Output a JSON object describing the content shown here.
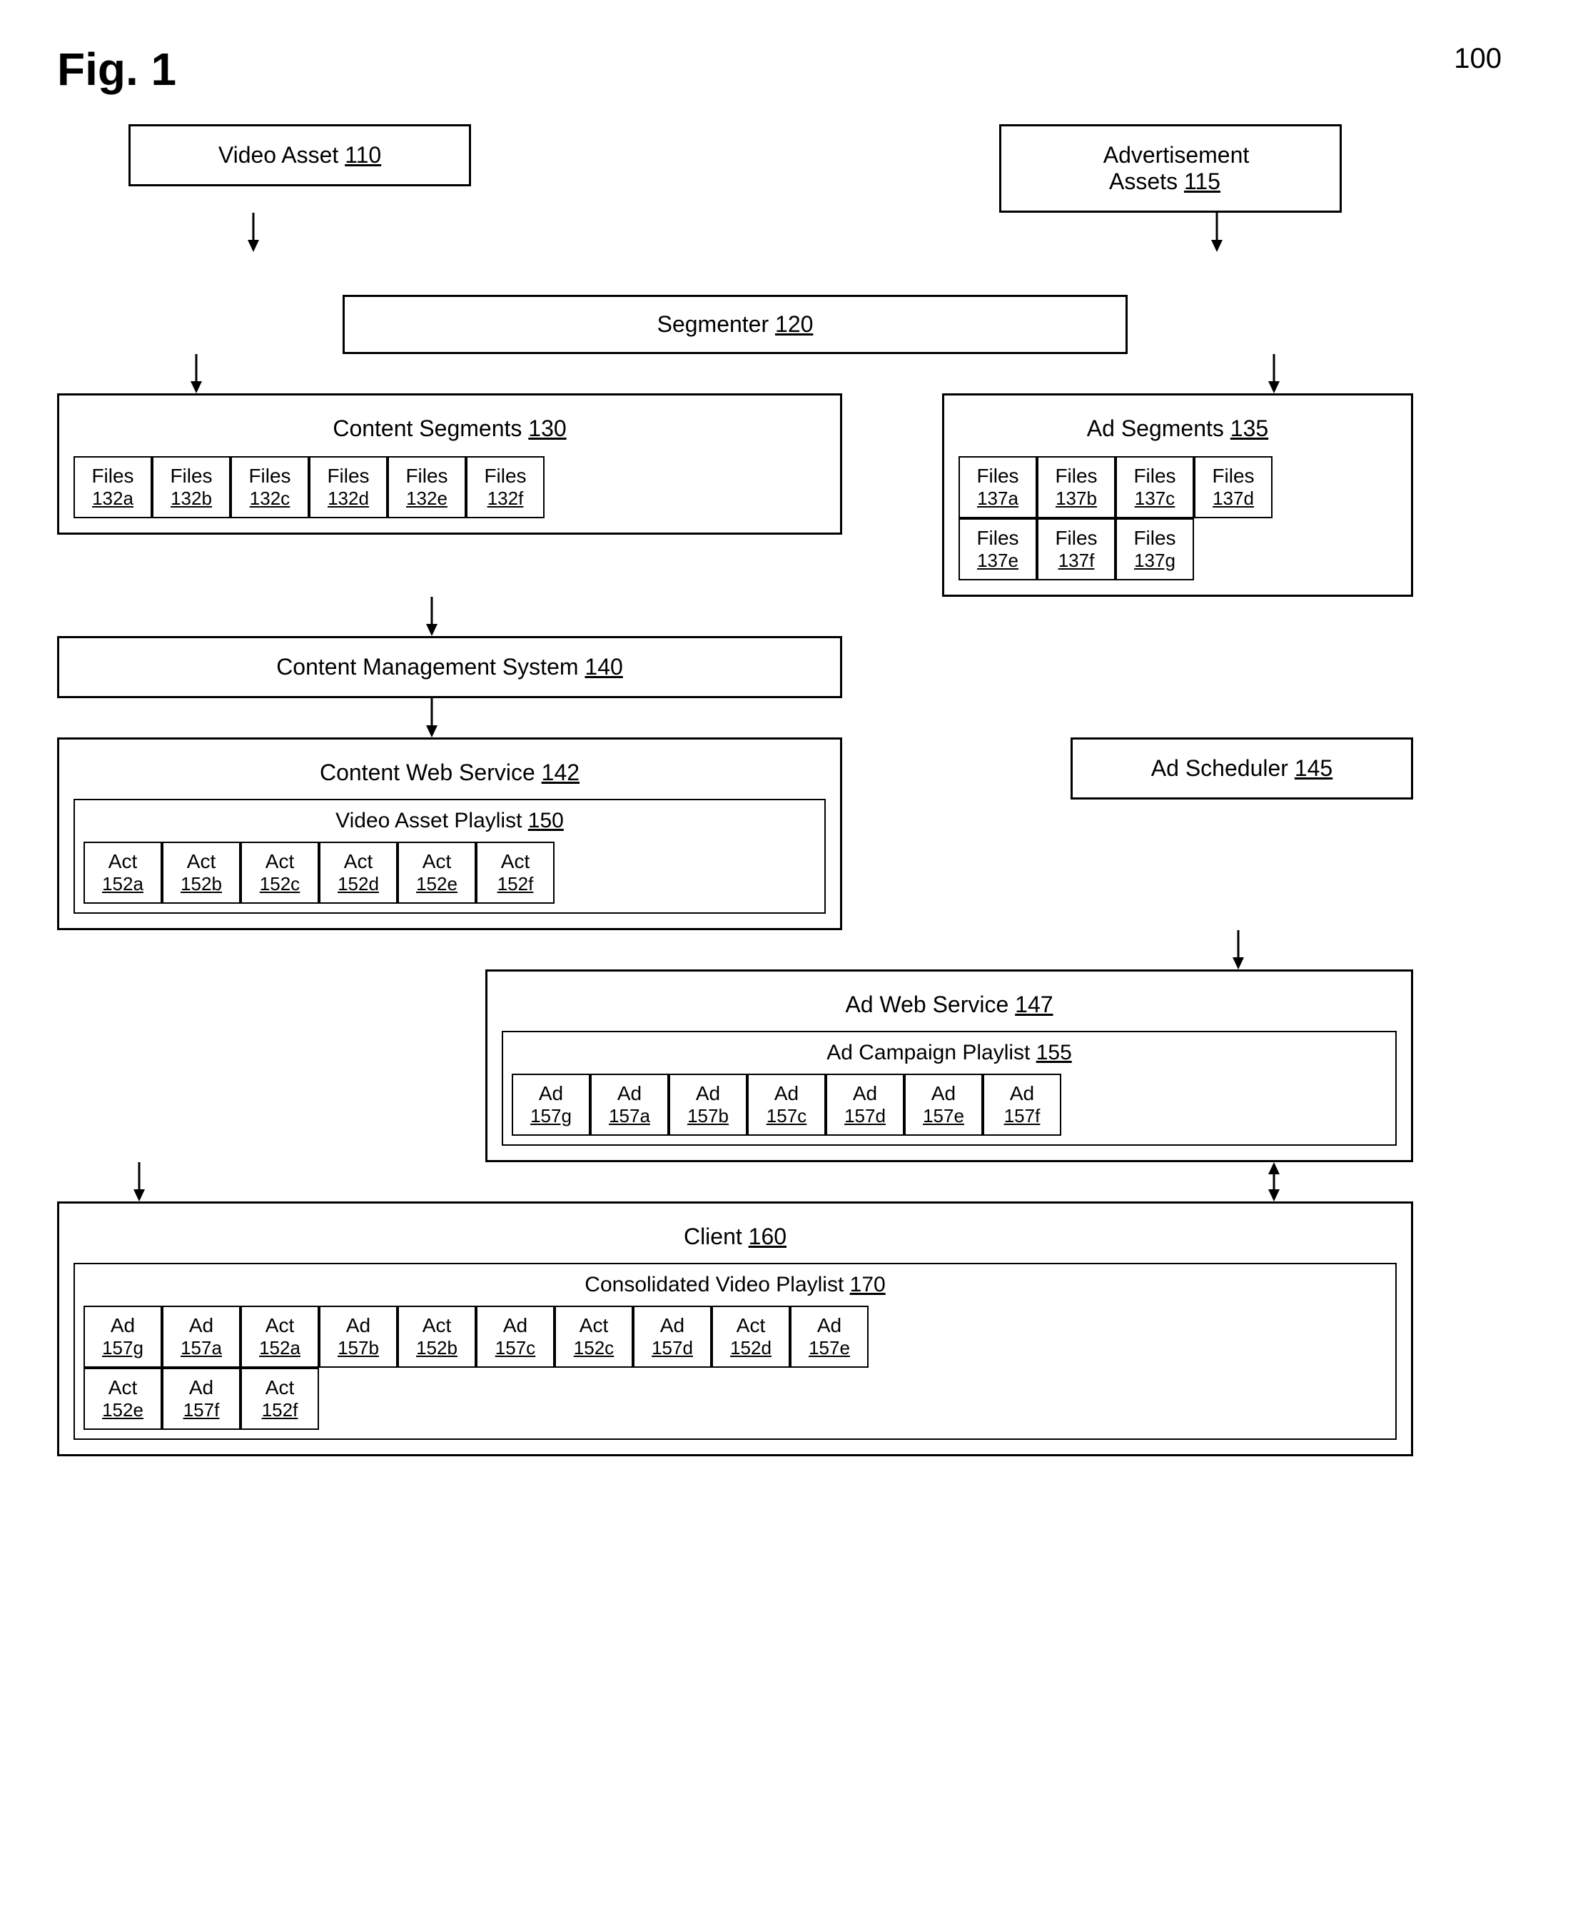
{
  "figure": {
    "label": "Fig. 1",
    "number": "100"
  },
  "boxes": {
    "videoAsset": {
      "label": "Video Asset",
      "ref": "110"
    },
    "adAssets": {
      "label": "Advertisement\nAssets",
      "ref": "115"
    },
    "segmenter": {
      "label": "Segmenter",
      "ref": "120"
    },
    "contentSegments": {
      "label": "Content Segments",
      "ref": "130"
    },
    "adSegments": {
      "label": "Ad Segments",
      "ref": "135"
    },
    "cms": {
      "label": "Content Management System",
      "ref": "140"
    },
    "contentWebService": {
      "label": "Content Web Service",
      "ref": "142"
    },
    "videoAssetPlaylist": {
      "label": "Video Asset Playlist",
      "ref": "150"
    },
    "adScheduler": {
      "label": "Ad Scheduler",
      "ref": "145"
    },
    "adWebService": {
      "label": "Ad Web Service",
      "ref": "147"
    },
    "adCampaignPlaylist": {
      "label": "Ad Campaign Playlist",
      "ref": "155"
    },
    "client": {
      "label": "Client",
      "ref": "160"
    },
    "consolidatedVideoPlaylist": {
      "label": "Consolidated Video Playlist",
      "ref": "170"
    }
  },
  "contentFiles": [
    {
      "label": "Files",
      "ref": "132a"
    },
    {
      "label": "Files",
      "ref": "132b"
    },
    {
      "label": "Files",
      "ref": "132c"
    },
    {
      "label": "Files",
      "ref": "132d"
    },
    {
      "label": "Files",
      "ref": "132e"
    },
    {
      "label": "Files",
      "ref": "132f"
    }
  ],
  "adFiles": [
    {
      "label": "Files",
      "ref": "137a"
    },
    {
      "label": "Files",
      "ref": "137b"
    },
    {
      "label": "Files",
      "ref": "137c"
    },
    {
      "label": "Files",
      "ref": "137d"
    },
    {
      "label": "Files",
      "ref": "137e"
    },
    {
      "label": "Files",
      "ref": "137f"
    },
    {
      "label": "Files",
      "ref": "137g"
    }
  ],
  "videoPlaylistActs": [
    {
      "label": "Act",
      "ref": "152a"
    },
    {
      "label": "Act",
      "ref": "152b"
    },
    {
      "label": "Act",
      "ref": "152c"
    },
    {
      "label": "Act",
      "ref": "152d"
    },
    {
      "label": "Act",
      "ref": "152e"
    },
    {
      "label": "Act",
      "ref": "152f"
    }
  ],
  "adCampaignAds": [
    {
      "label": "Ad",
      "ref": "157g"
    },
    {
      "label": "Ad",
      "ref": "157a"
    },
    {
      "label": "Ad",
      "ref": "157b"
    },
    {
      "label": "Ad",
      "ref": "157c"
    },
    {
      "label": "Ad",
      "ref": "157d"
    },
    {
      "label": "Ad",
      "ref": "157e"
    },
    {
      "label": "Ad",
      "ref": "157f"
    }
  ],
  "consolidatedItems": [
    {
      "label": "Ad",
      "ref": "157g"
    },
    {
      "label": "Ad",
      "ref": "157a"
    },
    {
      "label": "Act",
      "ref": "152a"
    },
    {
      "label": "Ad",
      "ref": "157b"
    },
    {
      "label": "Act",
      "ref": "152b"
    },
    {
      "label": "Ad",
      "ref": "157c"
    },
    {
      "label": "Act",
      "ref": "152c"
    },
    {
      "label": "Ad",
      "ref": "157d"
    },
    {
      "label": "Act",
      "ref": "152d"
    },
    {
      "label": "Ad",
      "ref": "157e"
    },
    {
      "label": "Act",
      "ref": "152e"
    },
    {
      "label": "Ad",
      "ref": "157f"
    },
    {
      "label": "Act",
      "ref": "152f"
    }
  ]
}
